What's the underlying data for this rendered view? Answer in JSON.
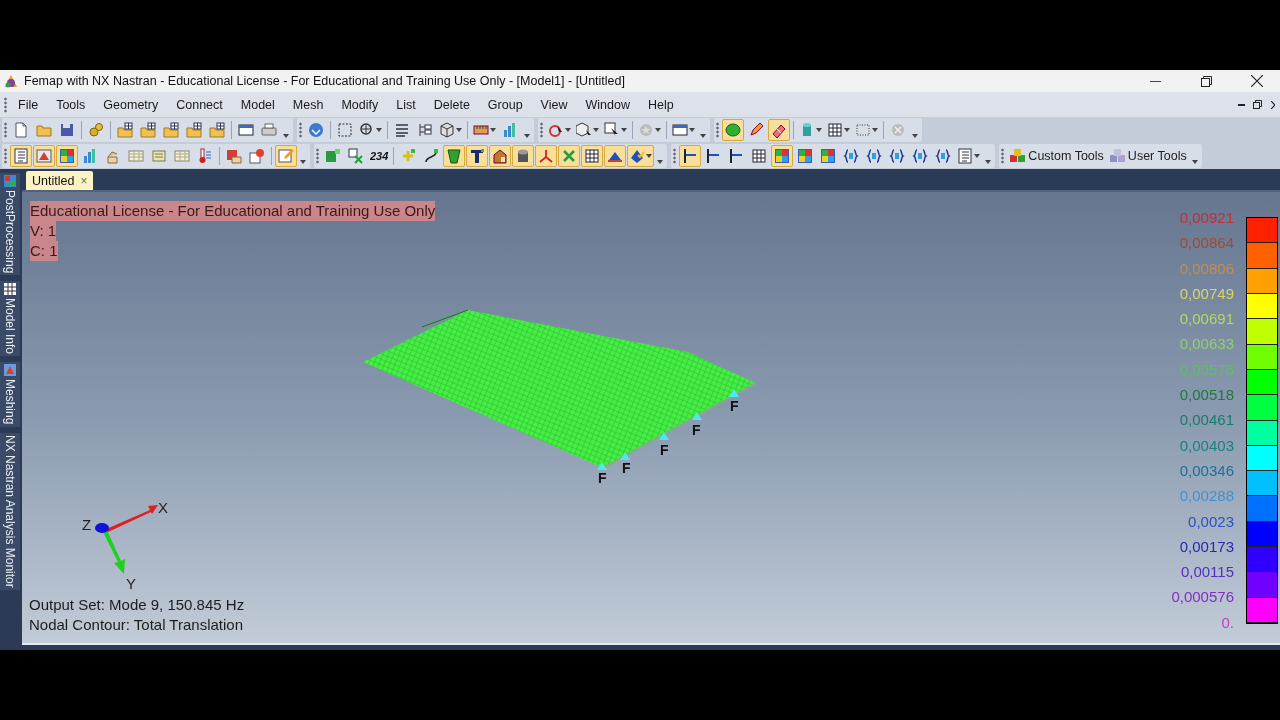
{
  "window": {
    "title": "Femap with NX Nastran - Educational License - For Educational and Training Use Only - [Model1] - [Untitled]"
  },
  "menu": [
    "File",
    "Tools",
    "Geometry",
    "Connect",
    "Model",
    "Mesh",
    "Modify",
    "List",
    "Delete",
    "Group",
    "View",
    "Window",
    "Help"
  ],
  "toolbar_rows": [
    {
      "groups": [
        {
          "buttons": [
            {
              "on": false
            },
            {
              "on": false
            },
            {
              "on": false
            },
            {
              "on": false
            },
            {
              "on": false
            },
            {
              "on": false
            },
            {
              "on": false
            },
            {
              "on": false
            },
            {
              "on": false
            },
            {
              "on": false
            },
            {
              "on": false
            }
          ]
        },
        {
          "buttons": [
            {
              "on": false
            },
            {
              "on": false
            },
            {
              "on": false
            },
            {
              "on": false
            },
            {
              "on": false
            },
            {
              "on": false
            },
            {
              "on": false
            },
            {
              "on": false
            }
          ]
        },
        {
          "buttons": [
            {
              "on": false
            },
            {
              "on": false
            },
            {
              "on": false
            },
            {
              "on": false
            },
            {
              "on": false
            }
          ]
        },
        {
          "buttons": [
            {
              "on": true
            },
            {
              "on": false
            },
            {
              "on": true
            },
            {
              "on": false
            },
            {
              "on": false
            },
            {
              "on": false
            },
            {
              "on": false
            }
          ]
        }
      ]
    },
    {
      "groups": [
        {
          "buttons": [
            {
              "on": true
            },
            {
              "on": true
            },
            {
              "on": true
            },
            {
              "on": false
            },
            {
              "on": false
            },
            {
              "on": false
            },
            {
              "on": false
            },
            {
              "on": false
            },
            {
              "on": false
            },
            {
              "on": false
            },
            {
              "on": false
            },
            {
              "on": true
            }
          ]
        },
        {
          "buttons": [
            {
              "on": false
            },
            {
              "on": false
            },
            {
              "on": false,
              "label": "234"
            },
            {
              "on": false
            },
            {
              "on": false
            },
            {
              "on": true
            },
            {
              "on": true
            },
            {
              "on": true
            },
            {
              "on": true
            },
            {
              "on": true
            },
            {
              "on": true
            },
            {
              "on": true
            },
            {
              "on": true
            },
            {
              "on": true
            }
          ]
        },
        {
          "buttons": [
            {
              "on": true
            },
            {
              "on": false
            },
            {
              "on": false
            },
            {
              "on": false
            },
            {
              "on": true
            },
            {
              "on": false
            },
            {
              "on": false
            },
            {
              "on": false
            },
            {
              "on": false
            },
            {
              "on": false
            },
            {
              "on": false
            },
            {
              "on": false
            },
            {
              "on": false
            }
          ]
        }
      ],
      "tool_buttons": [
        {
          "label": "Custom Tools"
        },
        {
          "label": "User Tools"
        }
      ]
    }
  ],
  "side_tabs": [
    {
      "label": "PostProcessing",
      "selected": false
    },
    {
      "label": "Model Info",
      "selected": false
    },
    {
      "label": "Meshing",
      "selected": false
    },
    {
      "label": "NX Nastran Analysis Monitor",
      "selected": false
    }
  ],
  "document_tabs": [
    {
      "label": "Untitled",
      "close": "×",
      "selected": true
    }
  ],
  "viewport": {
    "license_lines": [
      "Educational License - For Educational and Training Use Only",
      "V: 1",
      "C: 1"
    ],
    "constraint_labels": [
      "F",
      "F",
      "F",
      "F",
      "F"
    ],
    "triad": {
      "x": "X",
      "y": "Y",
      "z": "Z"
    },
    "info_lines": [
      "Output Set: Mode 9, 150.845 Hz",
      "Nodal Contour: Total Translation"
    ],
    "legend": [
      {
        "text": "0,00921",
        "color": "#c0303a"
      },
      {
        "text": "0,00864",
        "color": "#a04838"
      },
      {
        "text": "0,00806",
        "color": "#c09050"
      },
      {
        "text": "0,00749",
        "color": "#d8d860"
      },
      {
        "text": "0,00691",
        "color": "#b8d860"
      },
      {
        "text": "0,00633",
        "color": "#90d070"
      },
      {
        "text": "0,00576",
        "color": "#60c060"
      },
      {
        "text": "0,00518",
        "color": "#1e7a3a"
      },
      {
        "text": "0,00461",
        "color": "#1a7a70"
      },
      {
        "text": "0,00403",
        "color": "#1a8080"
      },
      {
        "text": "0,00346",
        "color": "#1a7096"
      },
      {
        "text": "0,00288",
        "color": "#4090d0"
      },
      {
        "text": "0,0023",
        "color": "#3050c0"
      },
      {
        "text": "0,00173",
        "color": "#2828b0"
      },
      {
        "text": "0,00115",
        "color": "#5030c0"
      },
      {
        "text": "0,000576",
        "color": "#8030c0"
      },
      {
        "text": "0.",
        "color": "#c040c0"
      }
    ]
  }
}
